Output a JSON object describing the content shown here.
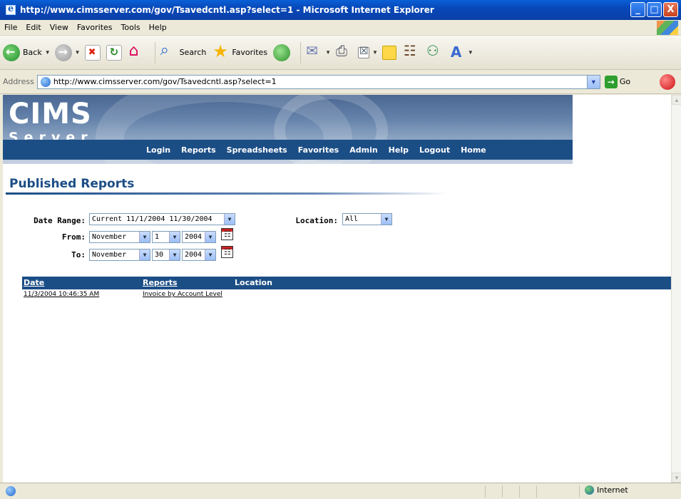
{
  "window": {
    "title": "http://www.cimsserver.com/gov/Tsavedcntl.asp?select=1 - Microsoft Internet Explorer",
    "minimize": "_",
    "maximize": "□",
    "close": "X"
  },
  "menu": [
    "File",
    "Edit",
    "View",
    "Favorites",
    "Tools",
    "Help"
  ],
  "toolbar": {
    "back_label": "Back",
    "search_label": "Search",
    "favorites_label": "Favorites"
  },
  "address": {
    "label": "Address",
    "url": "http://www.cimsserver.com/gov/Tsavedcntl.asp?select=1",
    "go_label": "Go"
  },
  "site": {
    "logo_top": "CIMS",
    "logo_bottom": "Server",
    "nav": [
      "Login",
      "Reports",
      "Spreadsheets",
      "Favorites",
      "Admin",
      "Help",
      "Logout",
      "Home"
    ]
  },
  "page": {
    "heading": "Published Reports"
  },
  "form": {
    "date_range_label": "Date Range:",
    "date_range_value": "Current 11/1/2004 11/30/2004",
    "location_label": "Location:",
    "location_value": "All",
    "from_label": "From:",
    "from_month": "November",
    "from_day": "1",
    "from_year": "2004",
    "to_label": "To:",
    "to_month": "November",
    "to_day": "30",
    "to_year": "2004"
  },
  "table": {
    "columns": [
      "Date",
      "Reports",
      "Location"
    ],
    "rows": [
      {
        "date": "11/3/2004 10:46:35 AM",
        "report": "Invoice by Account Level",
        "location": ""
      }
    ]
  },
  "status": {
    "zone": "Internet"
  }
}
